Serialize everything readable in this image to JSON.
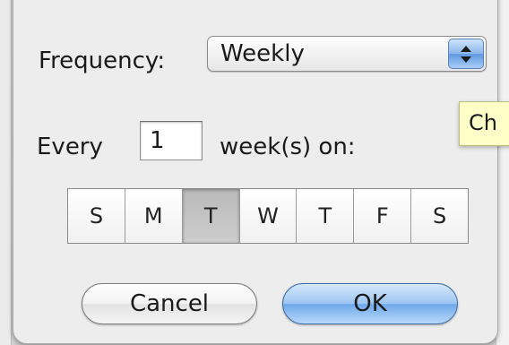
{
  "dialog": {
    "frequency_label": "Frequency:",
    "frequency_value": "Weekly",
    "every_label": "Every",
    "interval_value": "1",
    "interval_suffix": "week(s) on:",
    "days": [
      {
        "label": "S",
        "selected": false
      },
      {
        "label": "M",
        "selected": false
      },
      {
        "label": "T",
        "selected": true
      },
      {
        "label": "W",
        "selected": false
      },
      {
        "label": "T",
        "selected": false
      },
      {
        "label": "F",
        "selected": false
      },
      {
        "label": "S",
        "selected": false
      }
    ],
    "cancel_label": "Cancel",
    "ok_label": "OK"
  },
  "tooltip": {
    "text": "Ch"
  },
  "colors": {
    "default_button": "#8ab6ec",
    "tooltip_bg": "#ffffc8",
    "sheet_bg": "#ededed"
  },
  "icons": {
    "popup_stepper": "up-down-arrows-icon"
  }
}
